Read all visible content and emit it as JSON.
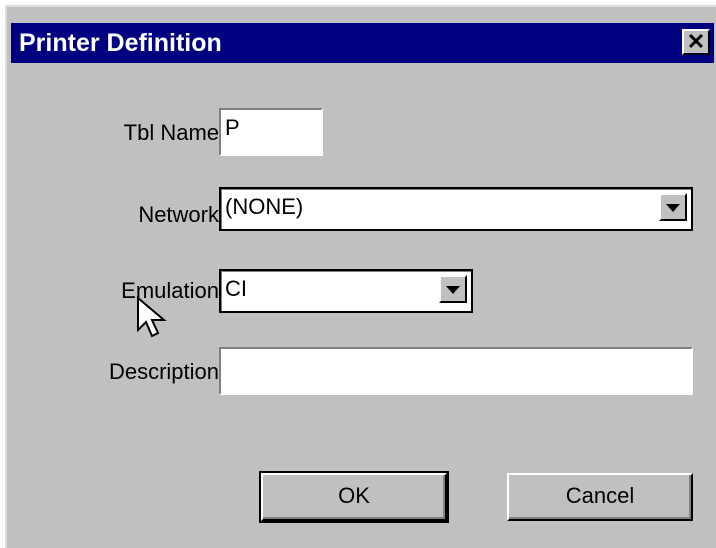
{
  "window": {
    "title": "Printer Definition",
    "close_glyph": "✕"
  },
  "form": {
    "tbl_name": {
      "label": "Tbl Name",
      "value": "P"
    },
    "network": {
      "label": "Network",
      "value": "(NONE)"
    },
    "emulation": {
      "label": "Emulation",
      "value": "CI"
    },
    "description": {
      "label": "Description",
      "value": ""
    }
  },
  "buttons": {
    "ok": "OK",
    "cancel": "Cancel"
  },
  "icons": {
    "close": "close-icon",
    "dropdown": "chevron-down-icon",
    "cursor": "mouse-cursor-icon"
  },
  "colors": {
    "titlebar": "#000080",
    "dialog_face": "#c0c0c0"
  }
}
